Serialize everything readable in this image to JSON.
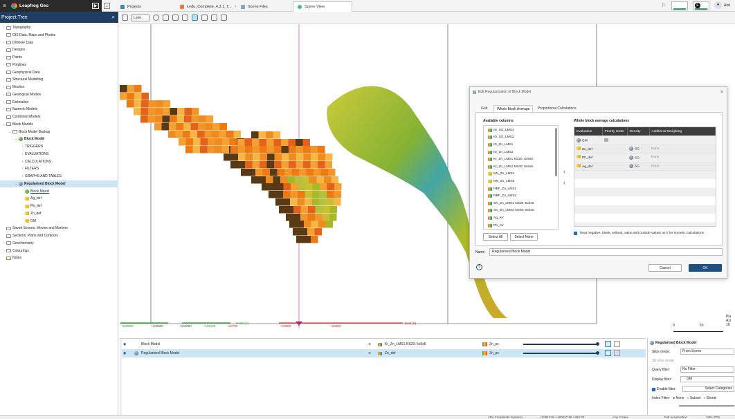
{
  "app": {
    "name": "Leapfrog Geo"
  },
  "tabs": [
    {
      "label": "Projects"
    },
    {
      "label": "Ledu_Complete_4.3.1_T..."
    },
    {
      "label": "Scene Files"
    },
    {
      "label": "Scene View"
    }
  ],
  "user": {
    "initials": "E",
    "name": "And"
  },
  "sidebar": {
    "title": "Project Tree",
    "items": [
      {
        "label": "Topography",
        "indent": 0,
        "arrow": "›",
        "icon": "folder"
      },
      {
        "label": "GIS Data, Maps and Photos",
        "indent": 0,
        "arrow": "",
        "icon": "folder"
      },
      {
        "label": "Drillhole Data",
        "indent": 0,
        "arrow": "›",
        "icon": "folder"
      },
      {
        "label": "Designs",
        "indent": 0,
        "arrow": "",
        "icon": "folder"
      },
      {
        "label": "Points",
        "indent": 0,
        "arrow": "›",
        "icon": "folder"
      },
      {
        "label": "Polylines",
        "indent": 0,
        "arrow": "›",
        "icon": "folder"
      },
      {
        "label": "Geophysical Data",
        "indent": 0,
        "arrow": "",
        "icon": "folder"
      },
      {
        "label": "Structural Modelling",
        "indent": 0,
        "arrow": "›",
        "icon": "folder"
      },
      {
        "label": "Meshes",
        "indent": 0,
        "arrow": "›",
        "icon": "folder"
      },
      {
        "label": "Geological Models",
        "indent": 0,
        "arrow": "›",
        "icon": "folder"
      },
      {
        "label": "Estimation",
        "indent": 0,
        "arrow": "›",
        "icon": "folder"
      },
      {
        "label": "Numeric Models",
        "indent": 0,
        "arrow": "›",
        "icon": "folder"
      },
      {
        "label": "Combined Models",
        "indent": 0,
        "arrow": "",
        "icon": "folder"
      },
      {
        "label": "Block Models",
        "indent": 0,
        "arrow": "⌄",
        "icon": "folder"
      },
      {
        "label": "Block Model Backup",
        "indent": 1,
        "arrow": "⌄",
        "icon": "folder"
      },
      {
        "label": "Block Model",
        "indent": 2,
        "arrow": "⌄",
        "icon": "green",
        "style": "bold"
      },
      {
        "label": "TRIGGERS",
        "indent": 3,
        "arrow": "›",
        "icon": "none"
      },
      {
        "label": "EVALUATIONS",
        "indent": 3,
        "arrow": "›",
        "icon": "none"
      },
      {
        "label": "CALCULATIONS",
        "indent": 3,
        "arrow": "›",
        "icon": "none"
      },
      {
        "label": "FILTERS",
        "indent": 3,
        "arrow": "›",
        "icon": "none"
      },
      {
        "label": "GRAPHS AND TABLES",
        "indent": 3,
        "arrow": "›",
        "icon": "none"
      },
      {
        "label": "Regularised Block Model",
        "indent": 2,
        "arrow": "⌄",
        "icon": "grey",
        "style": "bold",
        "selected": true
      },
      {
        "label": "Block Model",
        "indent": 3,
        "arrow": "",
        "icon": "green",
        "style": "link"
      },
      {
        "label": "Ag_def",
        "indent": 3,
        "arrow": "",
        "icon": "num"
      },
      {
        "label": "Pb_def",
        "indent": 3,
        "arrow": "",
        "icon": "num"
      },
      {
        "label": "Zn_def",
        "indent": 3,
        "arrow": "",
        "icon": "num"
      },
      {
        "label": "GM",
        "indent": 3,
        "arrow": "",
        "icon": "num"
      },
      {
        "label": "Saved Scenes, Movies and Markers",
        "indent": 0,
        "arrow": "",
        "icon": "folder"
      },
      {
        "label": "Sections, Plans and Contours",
        "indent": 0,
        "arrow": "",
        "icon": "folder"
      },
      {
        "label": "Geochemistry",
        "indent": 0,
        "arrow": "›",
        "icon": "folder"
      },
      {
        "label": "Colourings",
        "indent": 0,
        "arrow": "›",
        "icon": "folder"
      },
      {
        "label": "Notes",
        "indent": 0,
        "arrow": "",
        "icon": "note"
      }
    ]
  },
  "toolbar": {
    "look_label": "Look"
  },
  "scene": {
    "easting_labels": [
      "+100000",
      "+100900",
      "+101000",
      "+101100",
      "+10700",
      "+10800",
      "+10900"
    ],
    "axis_label": "North (Y)",
    "east_label": "East (X)",
    "scale_labels": [
      "0",
      "50"
    ],
    "right_labels": [
      "Plu",
      "Azi",
      "10"
    ]
  },
  "dialog": {
    "title": "Edit Regularisation of Block Model",
    "tabs": [
      "Grid",
      "Whole Block Average",
      "Proportional Calculations"
    ],
    "active_tab": "Whole Block Average",
    "available_label": "Available columns",
    "available": [
      "ID_SG_LMS1",
      "ID_SG_LMS2",
      "ID_Zn_LMS1",
      "ID_Zn_LMS2",
      "Kr_Zn_LMS1 NS20: 5x5x5",
      "Kr_Zn_LMS2 NS40: 5x5x5",
      "NN_Zn_LMS1",
      "NN_Zn_LMS2",
      "RBF_Zn_LMS1",
      "RBF_Zn_LMS2",
      "SK_Zn_LMS1 NS20: 5x5x5",
      "SK_Zn_LMS2 NS40: 5x5x5",
      "Ag_AV",
      "Pb_AV"
    ],
    "select_all": "Select All",
    "select_none": "Select None",
    "calc_label": "Whole block average calculations",
    "calc_headers": [
      "Evaluation",
      "Priority Order",
      "Density",
      "Additional Weighting"
    ],
    "calc_rows": [
      {
        "evaluation": "GM",
        "density": "",
        "weighting": ""
      },
      {
        "evaluation": "Zn_def",
        "density": "SG",
        "weighting": "None"
      },
      {
        "evaluation": "Pb_def",
        "density": "SG",
        "weighting": "None"
      },
      {
        "evaluation": "Ag_def",
        "density": "SG",
        "weighting": "None"
      }
    ],
    "treat_label": "Treat negative, blank, without_value and outside values as 0 for numeric calculations",
    "name_label": "Name",
    "name_value": "Regularised Block Model",
    "cancel": "Cancel",
    "ok": "OK"
  },
  "scene_list": [
    {
      "name": "Block Model",
      "column": "Kr_Zn_LMS1 NS20: 5x5x5",
      "colouring": "Zn_pc",
      "selected": false
    },
    {
      "name": "Regularised Block Model",
      "column": "Zn_def",
      "colouring": "Zn_pc",
      "selected": true
    }
  ],
  "properties": {
    "title": "Regularised Block Model",
    "slice_mode_label": "Slice mode:",
    "slice_mode_value": "From Scene",
    "ed_slice": "3D slice mode",
    "query_label": "Query filter:",
    "query_value": "No Filter",
    "display_label": "Display filter:",
    "display_value": "GM",
    "enable_filter": "Enable filter:",
    "select_categories": "Select Categories",
    "index_filter": "Index Filter:",
    "index_options": [
      "None",
      "Subset",
      "Sliced"
    ]
  },
  "status": {
    "coord": "<No Coordinate System>",
    "position": "+10912.94 +100527.68 +463.02",
    "code": "<No Code>",
    "accel": "Full Acceleration",
    "fps": "100+ FPS"
  },
  "colors": {
    "accent": "#1f3e63",
    "select": "#cde6f7",
    "ok": "#1e4f80"
  }
}
